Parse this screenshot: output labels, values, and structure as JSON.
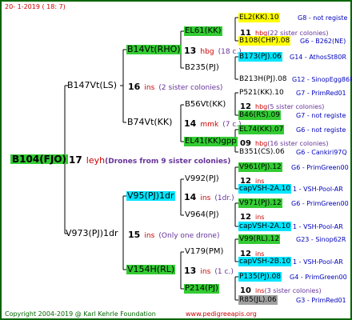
{
  "header": {
    "date": "20- 1-2019 ( 18: 7)"
  },
  "footer": {
    "copyright": "Copyright 2004-2019 @ Karl Kehrle Foundation",
    "url": "www.pedigreeapis.org"
  },
  "root": {
    "label": "B104(FJO)",
    "num": "17",
    "ins": "leyh",
    "note": "(Drones from 9 sister colonies)"
  },
  "gen1": {
    "top": {
      "label": "B147Vt(LS)",
      "num": "16",
      "ins": "ins",
      "note": "(2 sister colonies)"
    },
    "bottom": {
      "label": "V973(PJ)1dr",
      "num": "15",
      "ins": "ins",
      "note": "(Only one drone)"
    }
  },
  "gen2": {
    "a": {
      "label": "B14Vt(RHO)",
      "num": "13",
      "ins": "hbg",
      "note": "(18 c.)"
    },
    "b": {
      "label": "B74Vt(KK)",
      "num": "14",
      "ins": "mmk",
      "note": "(7 c.)"
    },
    "c": {
      "label": "V95(PJ)1dr",
      "num": "14",
      "ins": "ins",
      "note": "(1dr.)"
    },
    "d": {
      "label": "V154H(RL)",
      "num": "13",
      "ins": "ins",
      "note": "(1 c.)"
    }
  },
  "gen3": [
    {
      "label": "EL61(KK)",
      "num": "11",
      "ins": "hbg",
      "note": "(22 sister colonies)"
    },
    {
      "label": "B235(PJ)",
      "num": "",
      "ins": "",
      "note": ""
    },
    {
      "label": "B56Vt(KK)",
      "num": "12",
      "ins": "hbg",
      "note": "(5 sister colonies)"
    },
    {
      "label": "EL41(KK)gpp",
      "num": "09",
      "ins": "hbg",
      "note": "(16 sister colonies)"
    },
    {
      "label": "V992(PJ)",
      "num": "12",
      "ins": "ins",
      "note": ""
    },
    {
      "label": "V964(PJ)",
      "num": "12",
      "ins": "ins",
      "note": ""
    },
    {
      "label": "V179(PM)",
      "num": "12",
      "ins": "ins",
      "note": ""
    },
    {
      "label": "P214(PJ)",
      "num": "10",
      "ins": "ins",
      "note": "(3 sister colonies)"
    }
  ],
  "gen4": [
    {
      "label": "EL2(KK).10",
      "info": "G8 - not registe"
    },
    {
      "label": "B108(CHP).08",
      "info": "G6 - B262(NE)"
    },
    {
      "label": "B173(PJ).06",
      "info": "G14 - AthosSt80R"
    },
    {
      "label": "B213H(PJ).08",
      "info": "G12 - SinopEgg86R"
    },
    {
      "label": "P521(KK).10",
      "info": "G7 - PrimRed01"
    },
    {
      "label": "B46(RS).09",
      "info": "G7 - not registe"
    },
    {
      "label": "EL74(KK).07",
      "info": "G6 - not registe"
    },
    {
      "label": "B351(CS).06",
      "info": "G6 - Cankiri97Q"
    },
    {
      "label": "V961(PJ).12",
      "info": "G6 - PrimGreen00"
    },
    {
      "label": "capVSH-2A.10",
      "info": "1 - VSH-Pool-AR"
    },
    {
      "label": "V971(PJ).12",
      "info": "G6 - PrimGreen00"
    },
    {
      "label": "capVSH-2A.10",
      "info": "1 - VSH-Pool-AR"
    },
    {
      "label": "V99(RL).12",
      "info": "G23 - Sinop62R"
    },
    {
      "label": "capVSH-2B.10",
      "info": "1 - VSH-Pool-AR"
    },
    {
      "label": "P135(PJ).08",
      "info": "G4 - PrimGreen00"
    },
    {
      "label": "R85(JL).06",
      "info": "G3 - PrimRed01"
    }
  ],
  "colors": {
    "green": "#33cc33",
    "cyan": "#00e5ff",
    "yellow": "#ffff00",
    "grey": "#a0a0a0",
    "red": "#cc0000",
    "purple": "#663399",
    "blue": "#0000bb",
    "frame": "#006600"
  }
}
